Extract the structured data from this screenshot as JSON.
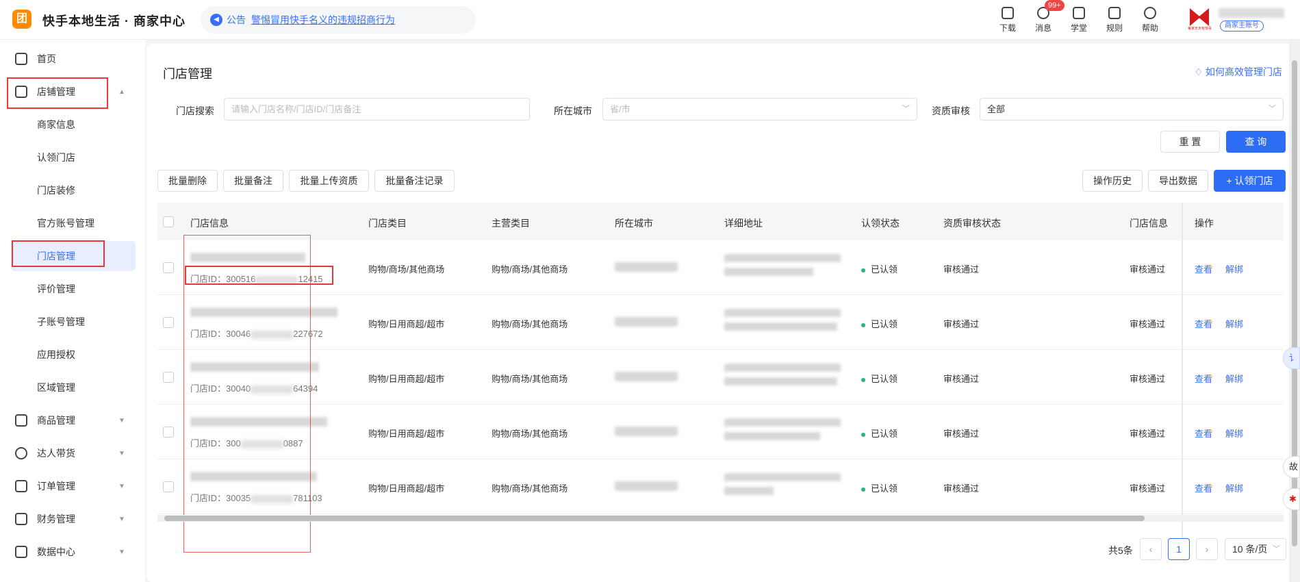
{
  "app": {
    "logo": "团",
    "title": "快手本地生活 · 商家中心"
  },
  "notice": {
    "label": "公告",
    "text": "警惕冒用快手名义的违规招商行为"
  },
  "toolbar": [
    {
      "label": "下载"
    },
    {
      "label": "消息",
      "badge": "99+"
    },
    {
      "label": "学堂"
    },
    {
      "label": "规则"
    },
    {
      "label": "帮助"
    }
  ],
  "user": {
    "logo_caption": "每家天天有惊喜",
    "tag": "商家主账号"
  },
  "sidebar": {
    "home": "首页",
    "store_mgmt": "店铺管理",
    "sub": [
      "商家信息",
      "认领门店",
      "门店装修",
      "官方账号管理",
      "门店管理",
      "评价管理",
      "子账号管理",
      "应用授权",
      "区域管理"
    ],
    "groups": [
      "商品管理",
      "达人带货",
      "订单管理",
      "财务管理",
      "数据中心"
    ]
  },
  "page": {
    "title": "门店管理",
    "help": "如何高效管理门店"
  },
  "filters": {
    "search_label": "门店搜索",
    "search_placeholder": "请输入门店名称/门店ID/门店备注",
    "city_label": "所在城市",
    "city_placeholder": "省/市",
    "qual_label": "资质审核",
    "qual_value": "全部",
    "reset": "重 置",
    "query": "查 询"
  },
  "actions": {
    "batch_delete": "批量删除",
    "batch_note": "批量备注",
    "batch_upload": "批量上传资质",
    "batch_note_log": "批量备注记录",
    "history": "操作历史",
    "export": "导出数据",
    "claim": "+ 认领门店"
  },
  "table": {
    "headers": [
      "门店信息",
      "门店类目",
      "主营类目",
      "所在城市",
      "详细地址",
      "认领状态",
      "资质审核状态",
      "门店信息",
      "操作"
    ],
    "rows": [
      {
        "id_prefix": "门店ID：300516",
        "id_suffix": "12415",
        "category": "购物/商场/其他商场",
        "main": "购物/商场/其他商场",
        "claim": "已认领",
        "qual": "审核通过",
        "info": "审核通过",
        "view": "查看",
        "unbind": "解绑"
      },
      {
        "id_prefix": "门店ID：30046",
        "id_suffix": "227672",
        "category": "购物/日用商超/超市",
        "main": "购物/商场/其他商场",
        "claim": "已认领",
        "qual": "审核通过",
        "info": "审核通过",
        "view": "查看",
        "unbind": "解绑"
      },
      {
        "id_prefix": "门店ID：30040",
        "id_suffix": "64394",
        "category": "购物/日用商超/超市",
        "main": "购物/商场/其他商场",
        "claim": "已认领",
        "qual": "审核通过",
        "info": "审核通过",
        "view": "查看",
        "unbind": "解绑"
      },
      {
        "id_prefix": "门店ID：300",
        "id_suffix": "0887",
        "category": "购物/日用商超/超市",
        "main": "购物/商场/其他商场",
        "claim": "已认领",
        "qual": "审核通过",
        "info": "审核通过",
        "view": "查看",
        "unbind": "解绑"
      },
      {
        "id_prefix": "门店ID：30035",
        "id_suffix": "781103",
        "category": "购物/日用商超/超市",
        "main": "购物/商场/其他商场",
        "claim": "已认领",
        "qual": "审核通过",
        "info": "审核通过",
        "view": "查看",
        "unbind": "解绑"
      }
    ]
  },
  "pagination": {
    "total": "共5条",
    "current": "1",
    "page_size": "10 条/页"
  },
  "colors": {
    "accent": "#2d6cf5",
    "highlight": "#e53935",
    "success": "#2bb673"
  },
  "side_float": {
    "a": "讠",
    "b": "故"
  }
}
